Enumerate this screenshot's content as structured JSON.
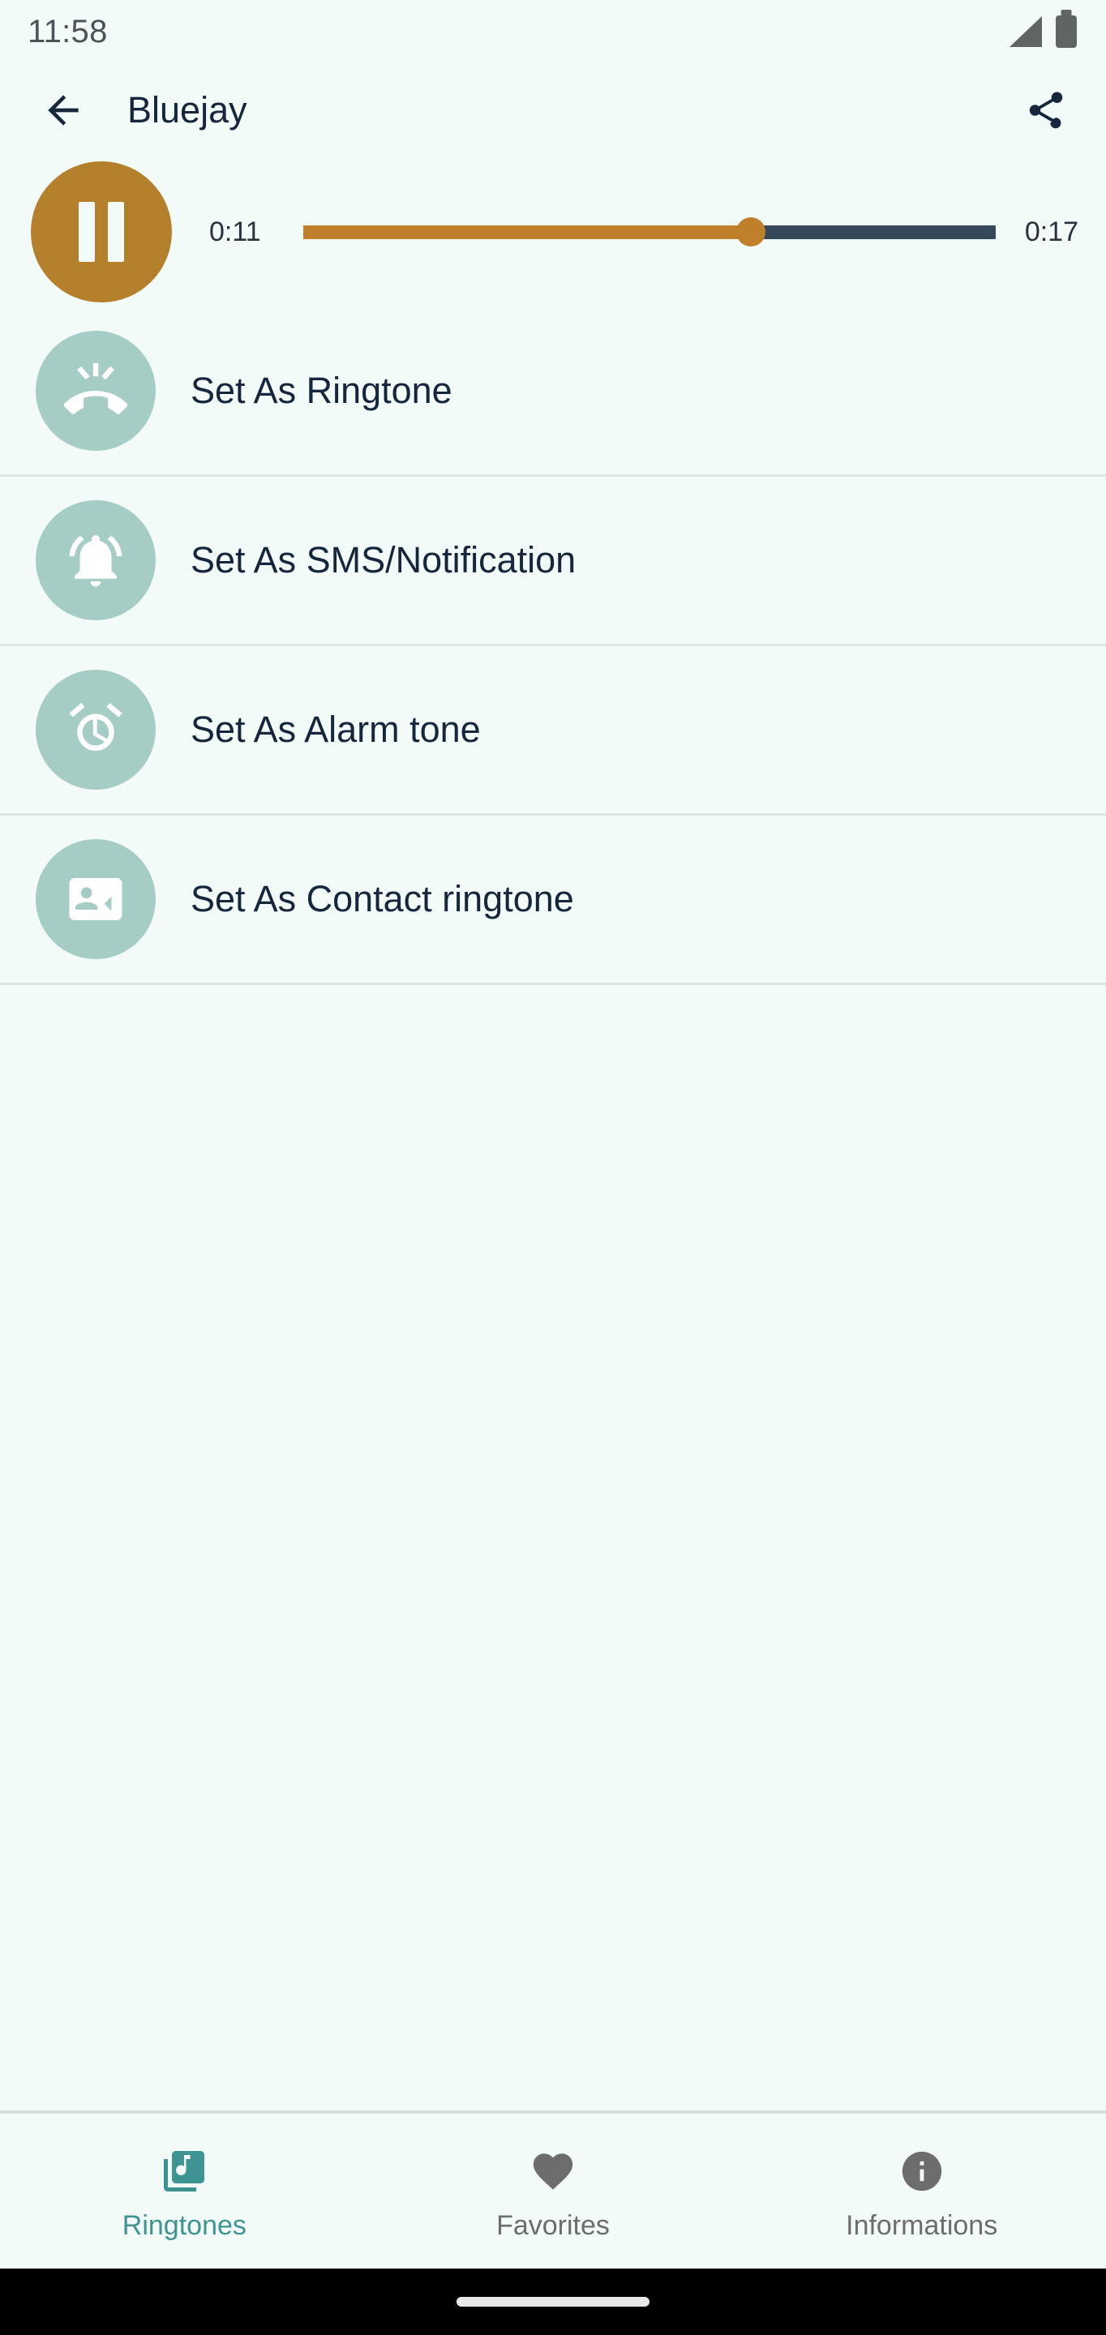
{
  "status_bar": {
    "clock": "11:58",
    "signal_icon": "signal-icon",
    "battery_icon": "battery-full-icon"
  },
  "app_bar": {
    "back_icon": "arrow-back-icon",
    "title": "Bluejay",
    "share_icon": "share-icon"
  },
  "player": {
    "play_pause_icon": "pause-icon",
    "state": "playing",
    "current_time": "0:11",
    "total_time": "0:17",
    "progress_percent": 64.7,
    "accent_color": "#B5802C",
    "track_color": "#36495A"
  },
  "options": [
    {
      "label": "Set As Ringtone",
      "icon": "ring-volume-icon"
    },
    {
      "label": "Set As SMS/Notification",
      "icon": "notifications-active-icon"
    },
    {
      "label": "Set As Alarm tone",
      "icon": "alarm-clock-icon"
    },
    {
      "label": "Set As Contact ringtone",
      "icon": "contact-phone-icon"
    }
  ],
  "bottom_nav": {
    "active_color": "#3E9490",
    "inactive_color": "#6D6D6D",
    "items": [
      {
        "label": "Ringtones",
        "icon": "library-music-icon",
        "active": true
      },
      {
        "label": "Favorites",
        "icon": "heart-icon",
        "active": false
      },
      {
        "label": "Informations",
        "icon": "info-icon",
        "active": false
      }
    ]
  },
  "colors": {
    "background": "#F2FBF7",
    "text_primary": "#16263D",
    "icon_circle": "#A6CCC6",
    "divider": "#DCE5E1"
  }
}
